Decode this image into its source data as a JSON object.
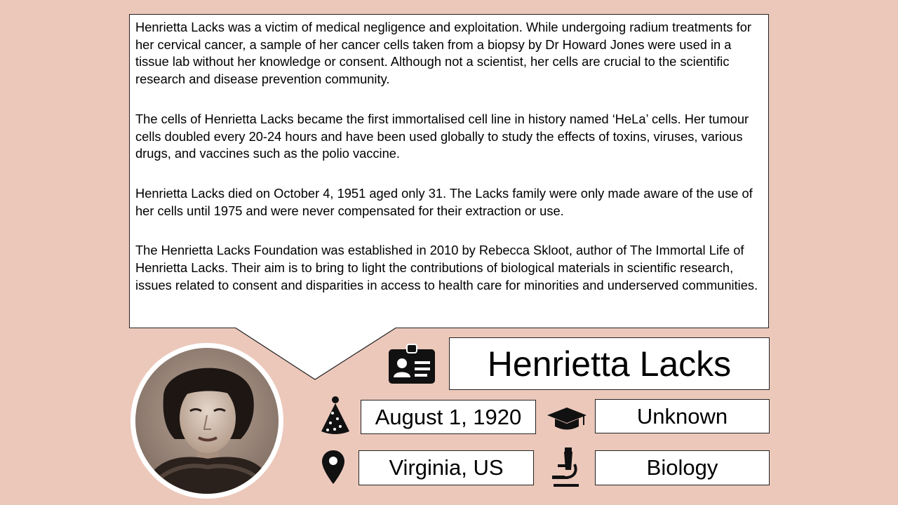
{
  "bio": {
    "paragraphs": [
      "Henrietta Lacks was a victim of medical negligence and exploitation. While undergoing radium treatments for her cervical cancer, a sample of her cancer cells taken from a biopsy by Dr Howard Jones were used in a tissue lab without her knowledge or consent. Although not a scientist, her cells are crucial to the scientific research and disease prevention community.",
      "The cells of Henrietta Lacks became the first immortalised cell line in history named ‘HeLa’ cells. Her tumour cells doubled every 20-24 hours and have been used globally to study the effects of toxins, viruses, various drugs, and vaccines such as the polio vaccine.",
      "Henrietta Lacks died on October 4, 1951 aged only 31. The Lacks family were only made aware of the use of her cells until 1975 and were never compensated for their extraction or use.",
      "The Henrietta Lacks Foundation was established in 2010 by Rebecca Skloot, author of The Immortal Life of Henrietta Lacks. Their aim is to bring to light the contributions of biological materials in scientific research, issues related to consent and disparities in access to health care for minorities and underserved communities."
    ]
  },
  "profile": {
    "name": "Henrietta Lacks",
    "birth_date": "August 1, 1920",
    "education": "Unknown",
    "location": "Virginia, US",
    "field": "Biology"
  },
  "icons": {
    "name": "id-card-icon",
    "birth_date": "party-hat-icon",
    "education": "graduation-cap-icon",
    "location": "map-pin-icon",
    "field": "microscope-icon"
  },
  "colors": {
    "background": "#ecc8bb",
    "box_fill": "#ffffff",
    "icon": "#111111"
  }
}
